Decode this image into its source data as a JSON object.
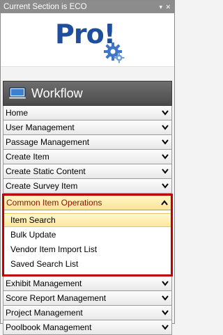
{
  "panel": {
    "title": "Current Section is ECO",
    "controls": "▾ ✕"
  },
  "logo": {
    "text": "Pro!"
  },
  "workflow": {
    "title": "Workflow",
    "icon": "computer-icon"
  },
  "menu": {
    "before": [
      "Home",
      "User Management",
      "Passage Management",
      "Create Item",
      "Create Static Content",
      "Create Survey Item"
    ],
    "expanded": {
      "label": "Common Item Operations",
      "subitems": [
        "Item Search",
        "Bulk Update",
        "Vendor Item Import List",
        "Saved Search List"
      ],
      "active_index": 0
    },
    "after": [
      "Exhibit Management",
      "Score Report Management",
      "Project Management",
      "Poolbook Management"
    ]
  },
  "colors": {
    "highlight_border": "#c00000",
    "title_bar": "#8c8c8c",
    "logo_blue": "#1f4f9c"
  }
}
